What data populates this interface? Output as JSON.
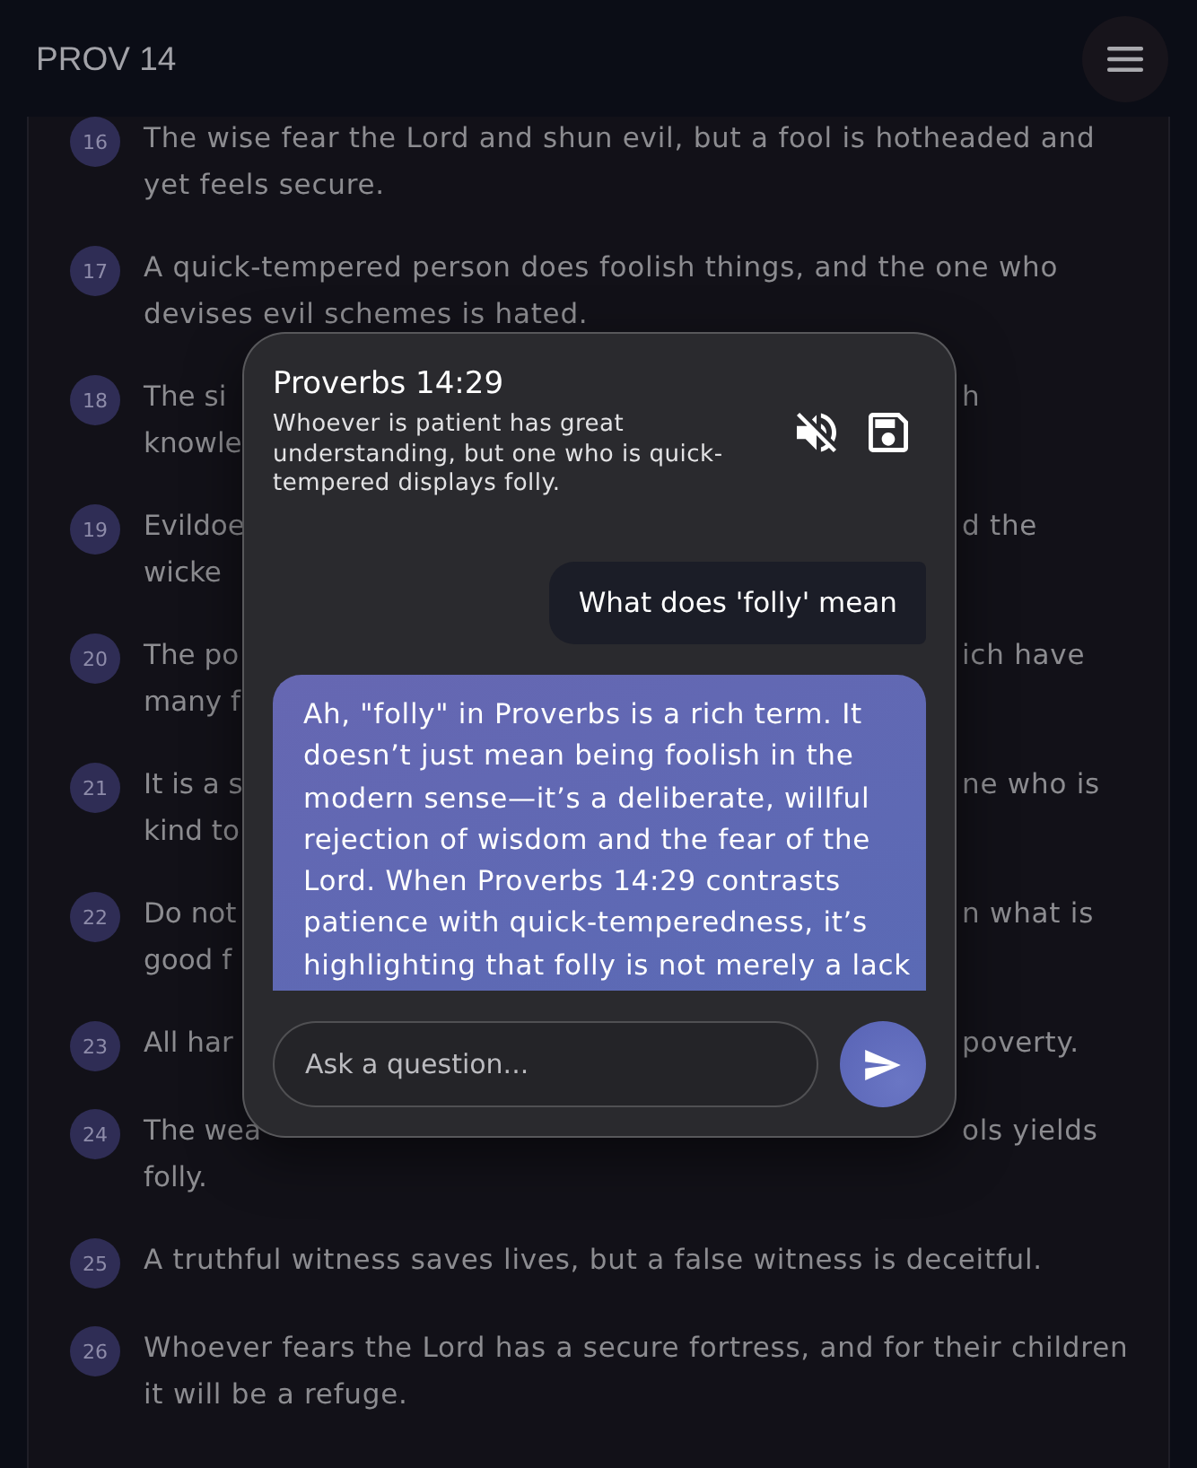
{
  "header": {
    "title": "PROV 14"
  },
  "verses": [
    {
      "number": "16",
      "kind": "full",
      "text": "The wise fear the Lord and shun evil, but a fool is hotheaded and yet feels secure."
    },
    {
      "number": "17",
      "kind": "full",
      "text": "A quick-tempered person does foolish things, and the one who devises evil schemes is hated."
    },
    {
      "number": "18",
      "kind": "covered",
      "lines": [
        {
          "left": "The si",
          "right": "h"
        },
        {
          "left": "knowle"
        }
      ]
    },
    {
      "number": "19",
      "kind": "covered",
      "lines": [
        {
          "left": "Evildoe",
          "right": "d the"
        },
        {
          "left": "wicke"
        }
      ]
    },
    {
      "number": "20",
      "kind": "covered",
      "lines": [
        {
          "left": "The po",
          "right": "ich have"
        },
        {
          "left": "many f"
        }
      ]
    },
    {
      "number": "21",
      "kind": "covered",
      "lines": [
        {
          "left": "It is a s",
          "right": "ne who is"
        },
        {
          "left": "kind to"
        }
      ]
    },
    {
      "number": "22",
      "kind": "covered",
      "lines": [
        {
          "left": "Do not",
          "right": "n what is"
        },
        {
          "left": "good f"
        }
      ]
    },
    {
      "number": "23",
      "kind": "covered",
      "lines": [
        {
          "left": "All har",
          "right": "poverty."
        }
      ]
    },
    {
      "number": "24",
      "kind": "covered",
      "lines": [
        {
          "left": "The wea",
          "right": "ols yields"
        },
        {
          "left": "folly."
        }
      ]
    },
    {
      "number": "25",
      "kind": "full",
      "text": "A truthful witness saves lives, but a false witness is deceitful."
    },
    {
      "number": "26",
      "kind": "full",
      "text": "Whoever fears the Lord has a secure fortress, and for their children it will be a refuge."
    }
  ],
  "dialog": {
    "title": "Proverbs 14:29",
    "verse_text": "Whoever is patient has great understanding, but one who is quick-tempered displays folly.",
    "muted": true,
    "messages": [
      {
        "kind": "user",
        "text": "What does 'folly' mean"
      },
      {
        "kind": "assistant",
        "text": "Ah, \"folly\" in Proverbs is a rich term. It doesn’t just mean being foolish in the modern sense—it’s a deliberate, willful rejection of wisdom and the fear of the Lord. When Proverbs 14:29 contrasts patience with quick-temperedness, it’s highlighting that folly is not merely a lack"
      }
    ],
    "input": {
      "placeholder": "Ask a question..."
    }
  }
}
